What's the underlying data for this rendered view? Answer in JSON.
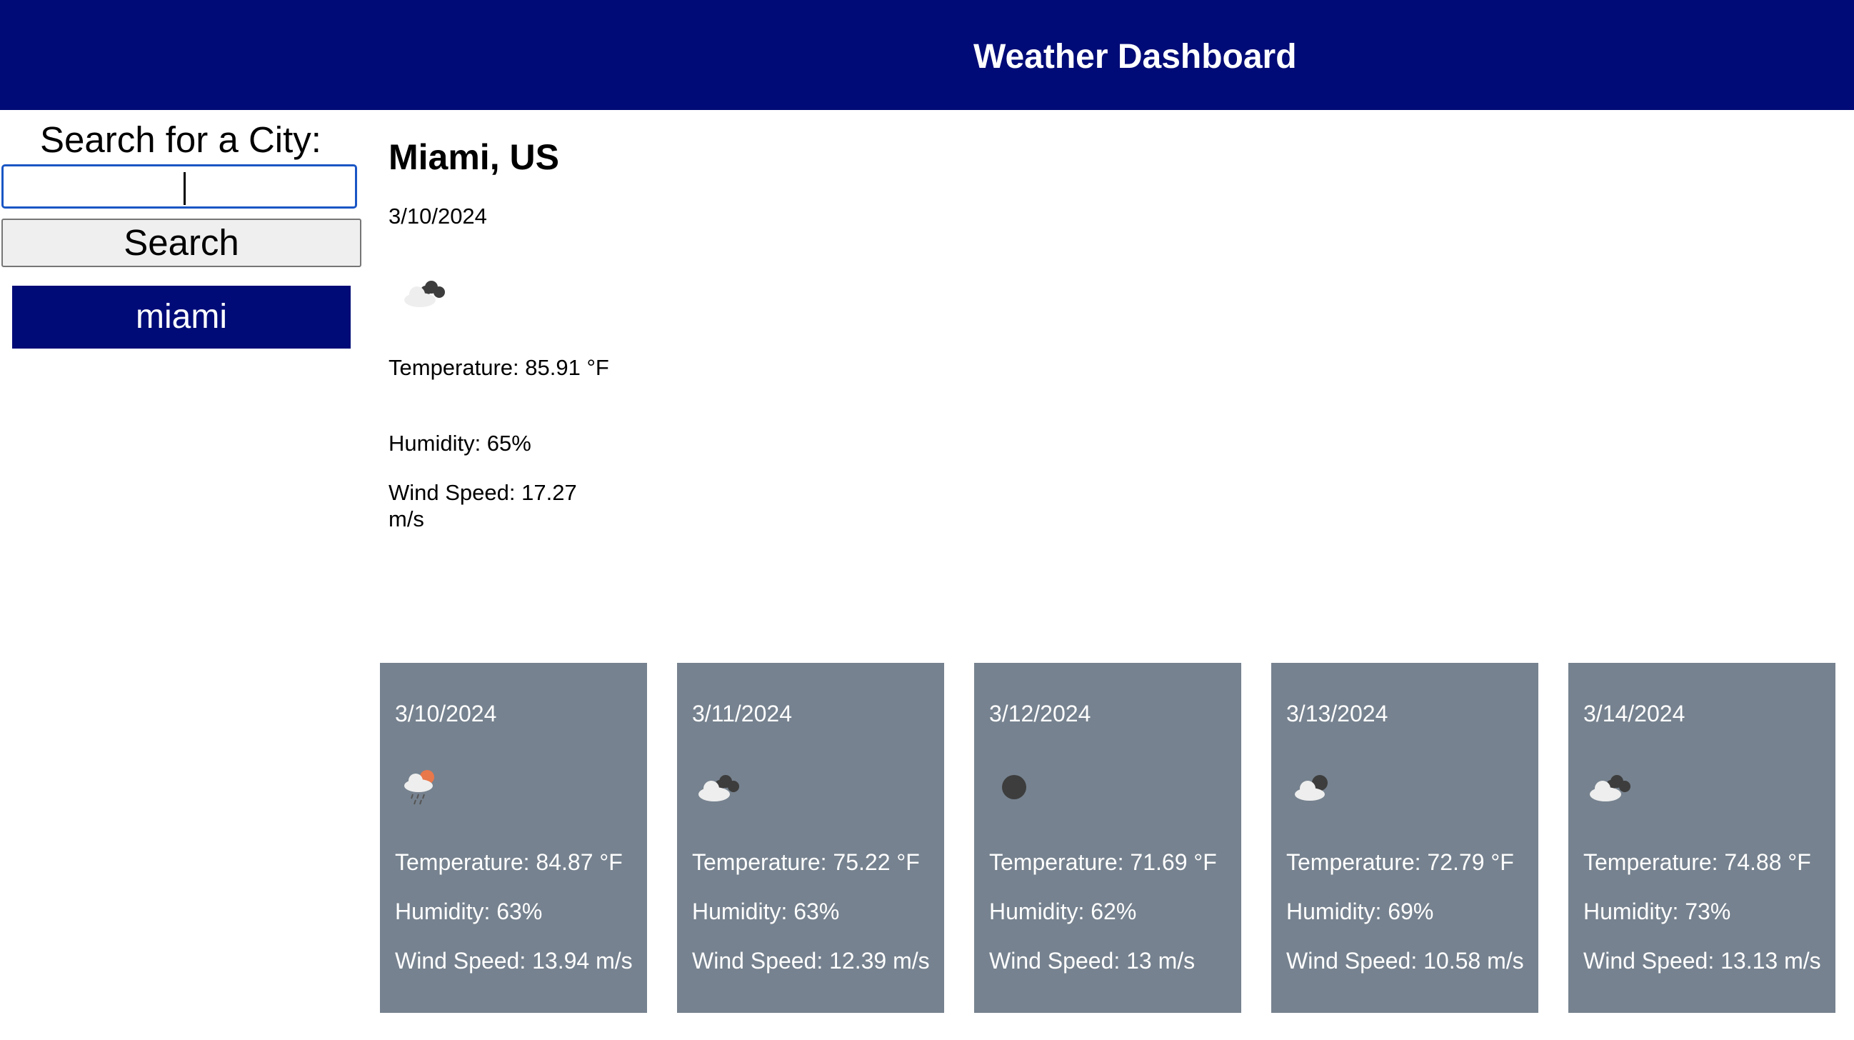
{
  "header": {
    "title": "Weather Dashboard"
  },
  "sidebar": {
    "label": "Search for a City:",
    "search_input": {
      "value": "",
      "placeholder": ""
    },
    "search_button": "Search",
    "history": [
      "miami"
    ]
  },
  "current": {
    "city": "Miami, US",
    "date": "3/10/2024",
    "icon": "cloudy-icon",
    "temperature": "Temperature: 85.91 °F",
    "humidity": "Humidity: 65%",
    "wind": "Wind Speed: 17.27 m/s"
  },
  "forecast": [
    {
      "date": "3/10/2024",
      "icon": "rain-sun-cloud-icon",
      "temperature": "Temperature: 84.87 °F",
      "humidity": "Humidity: 63%",
      "wind": "Wind Speed: 13.94 m/s"
    },
    {
      "date": "3/11/2024",
      "icon": "cloudy-icon",
      "temperature": "Temperature: 75.22 °F",
      "humidity": "Humidity: 63%",
      "wind": "Wind Speed: 12.39 m/s"
    },
    {
      "date": "3/12/2024",
      "icon": "clear-night-icon",
      "temperature": "Temperature: 71.69 °F",
      "humidity": "Humidity: 62%",
      "wind": "Wind Speed: 13 m/s"
    },
    {
      "date": "3/13/2024",
      "icon": "partly-cloudy-night-icon",
      "temperature": "Temperature: 72.79 °F",
      "humidity": "Humidity: 69%",
      "wind": "Wind Speed: 10.58 m/s"
    },
    {
      "date": "3/14/2024",
      "icon": "cloudy-icon",
      "temperature": "Temperature: 74.88 °F",
      "humidity": "Humidity: 73%",
      "wind": "Wind Speed: 13.13 m/s"
    }
  ],
  "colors": {
    "header_bg": "#000b77",
    "card_bg": "#76828f",
    "history_bg": "#000b77",
    "input_border": "#1a56c4"
  }
}
